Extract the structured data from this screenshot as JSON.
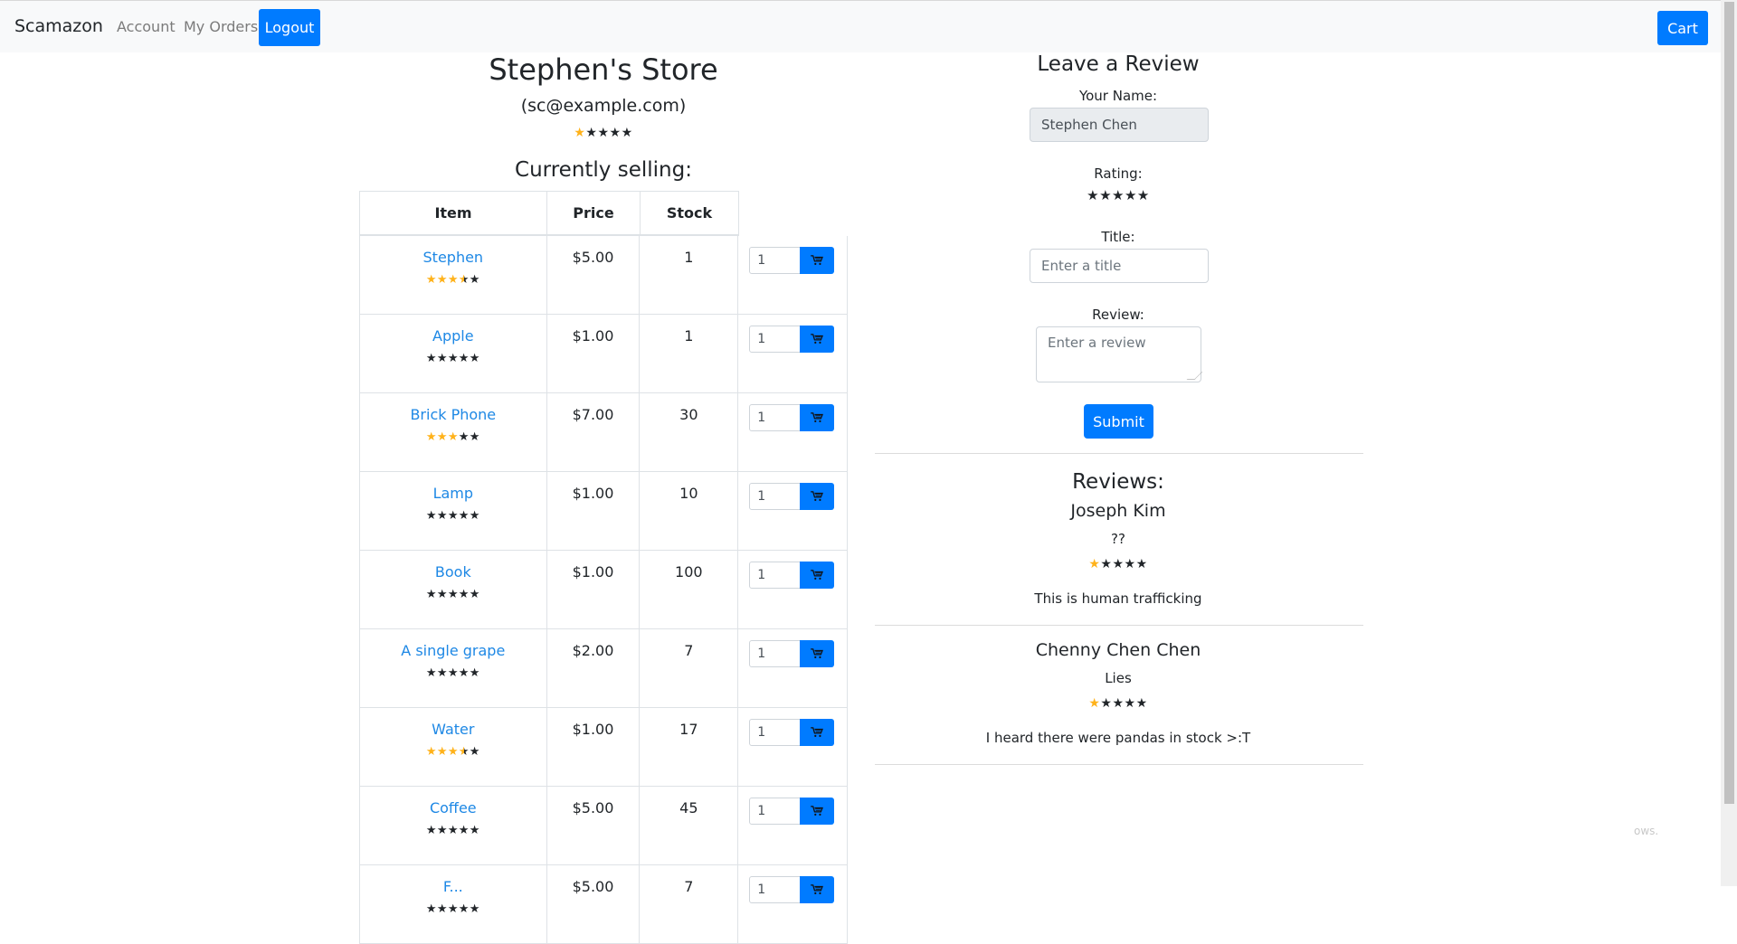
{
  "navbar": {
    "brand": "Scamazon",
    "account": "Account",
    "orders": "My Orders",
    "logout": "Logout",
    "cart": "Cart"
  },
  "store": {
    "title": "Stephen's Store",
    "email": "(sc@example.com)",
    "rating": 1,
    "selling_heading": "Currently selling:"
  },
  "table": {
    "headers": [
      "Item",
      "Price",
      "Stock"
    ],
    "rows": [
      {
        "name": "Stephen",
        "price": "$5.00",
        "stock": "1",
        "rating": 3.5,
        "qty": "1"
      },
      {
        "name": "Apple",
        "price": "$1.00",
        "stock": "1",
        "rating": 0,
        "qty": "1"
      },
      {
        "name": "Brick Phone",
        "price": "$7.00",
        "stock": "30",
        "rating": 3,
        "qty": "1"
      },
      {
        "name": "Lamp",
        "price": "$1.00",
        "stock": "10",
        "rating": 0,
        "qty": "1"
      },
      {
        "name": "Book",
        "price": "$1.00",
        "stock": "100",
        "rating": 0,
        "qty": "1"
      },
      {
        "name": "A single grape",
        "price": "$2.00",
        "stock": "7",
        "rating": 0,
        "qty": "1"
      },
      {
        "name": "Water",
        "price": "$1.00",
        "stock": "17",
        "rating": 3.5,
        "qty": "1"
      },
      {
        "name": "Coffee",
        "price": "$5.00",
        "stock": "45",
        "rating": 0,
        "qty": "1"
      },
      {
        "name": "F...",
        "price": "$5.00",
        "stock": "7",
        "rating": 0,
        "qty": "1"
      }
    ]
  },
  "review_form": {
    "heading": "Leave a Review",
    "name_label": "Your Name:",
    "name_value": "Stephen Chen",
    "rating_label": "Rating:",
    "rating_value": 0,
    "title_label": "Title:",
    "title_placeholder": "Enter a title",
    "review_label": "Review:",
    "review_placeholder": "Enter a review",
    "submit": "Submit"
  },
  "reviews": {
    "heading": "Reviews:",
    "items": [
      {
        "author": "Joseph Kim",
        "title": "??",
        "rating": 1,
        "body": "This is human trafficking"
      },
      {
        "author": "Chenny Chen Chen",
        "title": "Lies",
        "rating": 1,
        "body": "I heard there were pandas in stock >:T"
      }
    ]
  },
  "watermark": "ows.",
  "colors": {
    "primary": "#007bff",
    "link": "#1e88e5",
    "star_filled": "#ffb21a",
    "star_empty": "#212529"
  },
  "icons": [
    "cart-icon",
    "star-icon"
  ]
}
